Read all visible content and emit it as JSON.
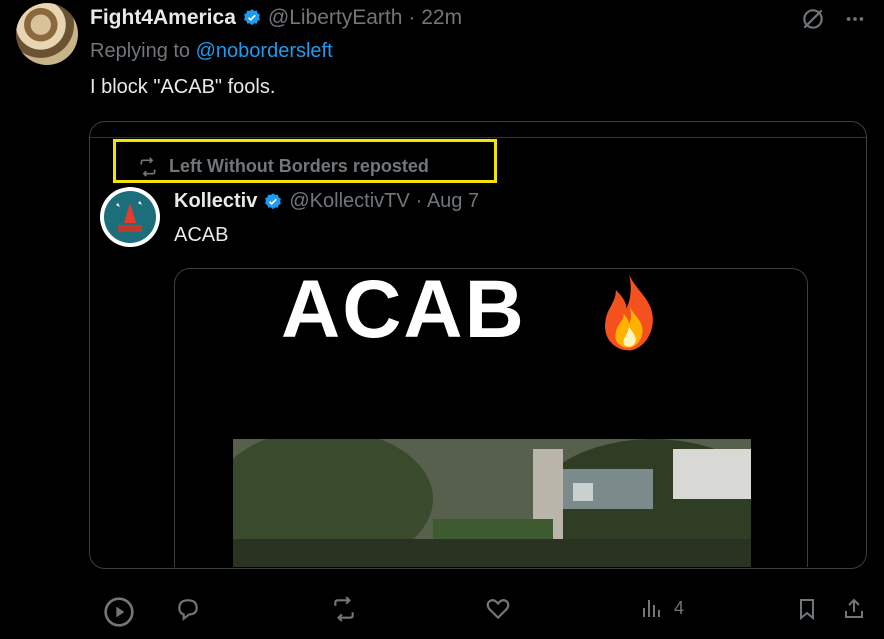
{
  "tweet": {
    "author_name": "Fight4America",
    "handle": "@LibertyEarth",
    "time": "· 22m",
    "replying_prefix": "Replying to",
    "replying_to": "@nobordersleft",
    "text": "I block \"ACAB\" fools."
  },
  "quote": {
    "repost_text": "Left Without Borders reposted",
    "author_name": "Kollectiv",
    "handle": "@KollectivTV",
    "date": "· Aug 7",
    "text": "ACAB",
    "media_title": "ACAB"
  },
  "actions": {
    "views_count": "4"
  },
  "colors": {
    "accent": "#1d9bf0",
    "highlight_box": "#f5e400",
    "muted": "#71767b"
  },
  "icons": [
    "verified-badge-icon",
    "grok-icon",
    "more-icon",
    "retweet-icon",
    "play-icon",
    "reply-icon",
    "like-icon",
    "views-icon",
    "bookmark-icon",
    "share-icon",
    "fire-emoji"
  ]
}
